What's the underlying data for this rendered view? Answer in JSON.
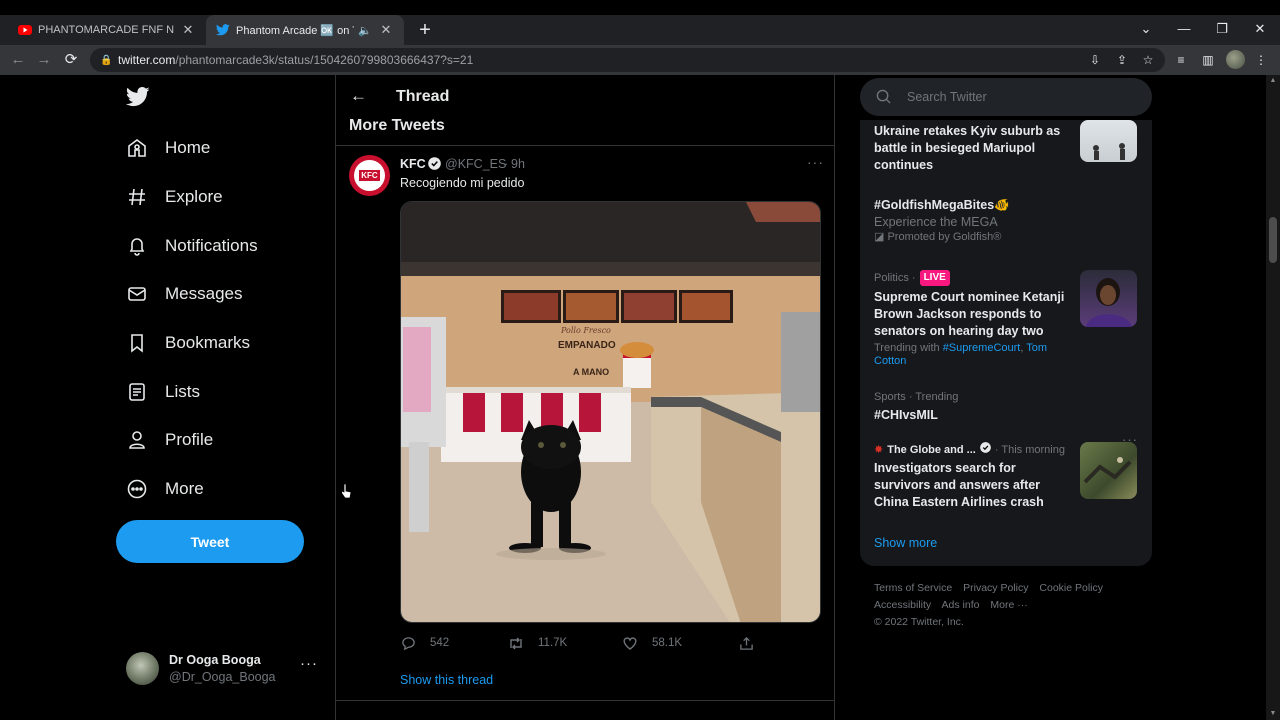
{
  "browser": {
    "tabs": [
      {
        "title": "PHANTOMARCADE FNF NEW TR",
        "favicon": "youtube-icon",
        "active": false
      },
      {
        "title": "Phantom Arcade 🆗 on Twitt",
        "favicon": "twitter-icon",
        "active": true
      }
    ],
    "url_host": "twitter.com",
    "url_path": "/phantomarcade3k/status/1504260799803666437?s=21"
  },
  "nav": {
    "items": [
      {
        "label": "Home",
        "icon": "home-icon"
      },
      {
        "label": "Explore",
        "icon": "hashtag-icon"
      },
      {
        "label": "Notifications",
        "icon": "bell-icon"
      },
      {
        "label": "Messages",
        "icon": "mail-icon"
      },
      {
        "label": "Bookmarks",
        "icon": "bookmark-icon"
      },
      {
        "label": "Lists",
        "icon": "list-icon"
      },
      {
        "label": "Profile",
        "icon": "person-icon"
      },
      {
        "label": "More",
        "icon": "more-circle-icon"
      }
    ],
    "tweet_button": "Tweet"
  },
  "account": {
    "name": "Dr Ooga Booga",
    "handle": "@Dr_Ooga_Booga"
  },
  "thread": {
    "title": "Thread",
    "section_title": "More Tweets",
    "tweet": {
      "author_name": "KFC",
      "author_handle": "@KFC_ES",
      "separator": "·",
      "time": "9h",
      "text": "Recogiendo mi pedido",
      "replies": "542",
      "retweets": "11.7K",
      "likes": "58.1K",
      "show_thread": "Show this thread",
      "media": {
        "menu_board_text_1": "Pollo Fresco",
        "menu_board_text_2": "EMPANADO",
        "menu_board_text_3": "A MANO"
      }
    }
  },
  "sidebar": {
    "search_placeholder": "Search Twitter",
    "trends": {
      "t1_headline": "Ukraine retakes Kyiv suburb as battle in besieged Mariupol continues",
      "t2_headline": "#GoldfishMegaBites🐠",
      "t2_sub": "Experience the MEGA",
      "t2_promo": "Promoted by Goldfish®",
      "t3_category": "Politics ·",
      "t3_live": "LIVE",
      "t3_headline": "Supreme Court nominee Ketanji Brown Jackson responds to senators on hearing day two",
      "t3_trending_prefix": "Trending with",
      "t3_link1": "#SupremeCourt",
      "t3_comma": ",",
      "t3_link2": "Tom Cotton",
      "t4_meta": "Sports · Trending",
      "t4_headline": "#CHIvsMIL",
      "t5_source": "The Globe and ...",
      "t5_time": "· This morning",
      "t5_headline": "Investigators search for survivors and answers after China Eastern Airlines crash"
    },
    "show_more": "Show more",
    "footer": {
      "terms": "Terms of Service",
      "privacy": "Privacy Policy",
      "cookie": "Cookie Policy",
      "accessibility": "Accessibility",
      "ads": "Ads info",
      "more": "More ···",
      "copyright": "© 2022 Twitter, Inc."
    }
  },
  "colors": {
    "accent": "#1d9bf0",
    "background": "#000000",
    "live": "#f91880",
    "kfc_red": "#c8102e"
  }
}
